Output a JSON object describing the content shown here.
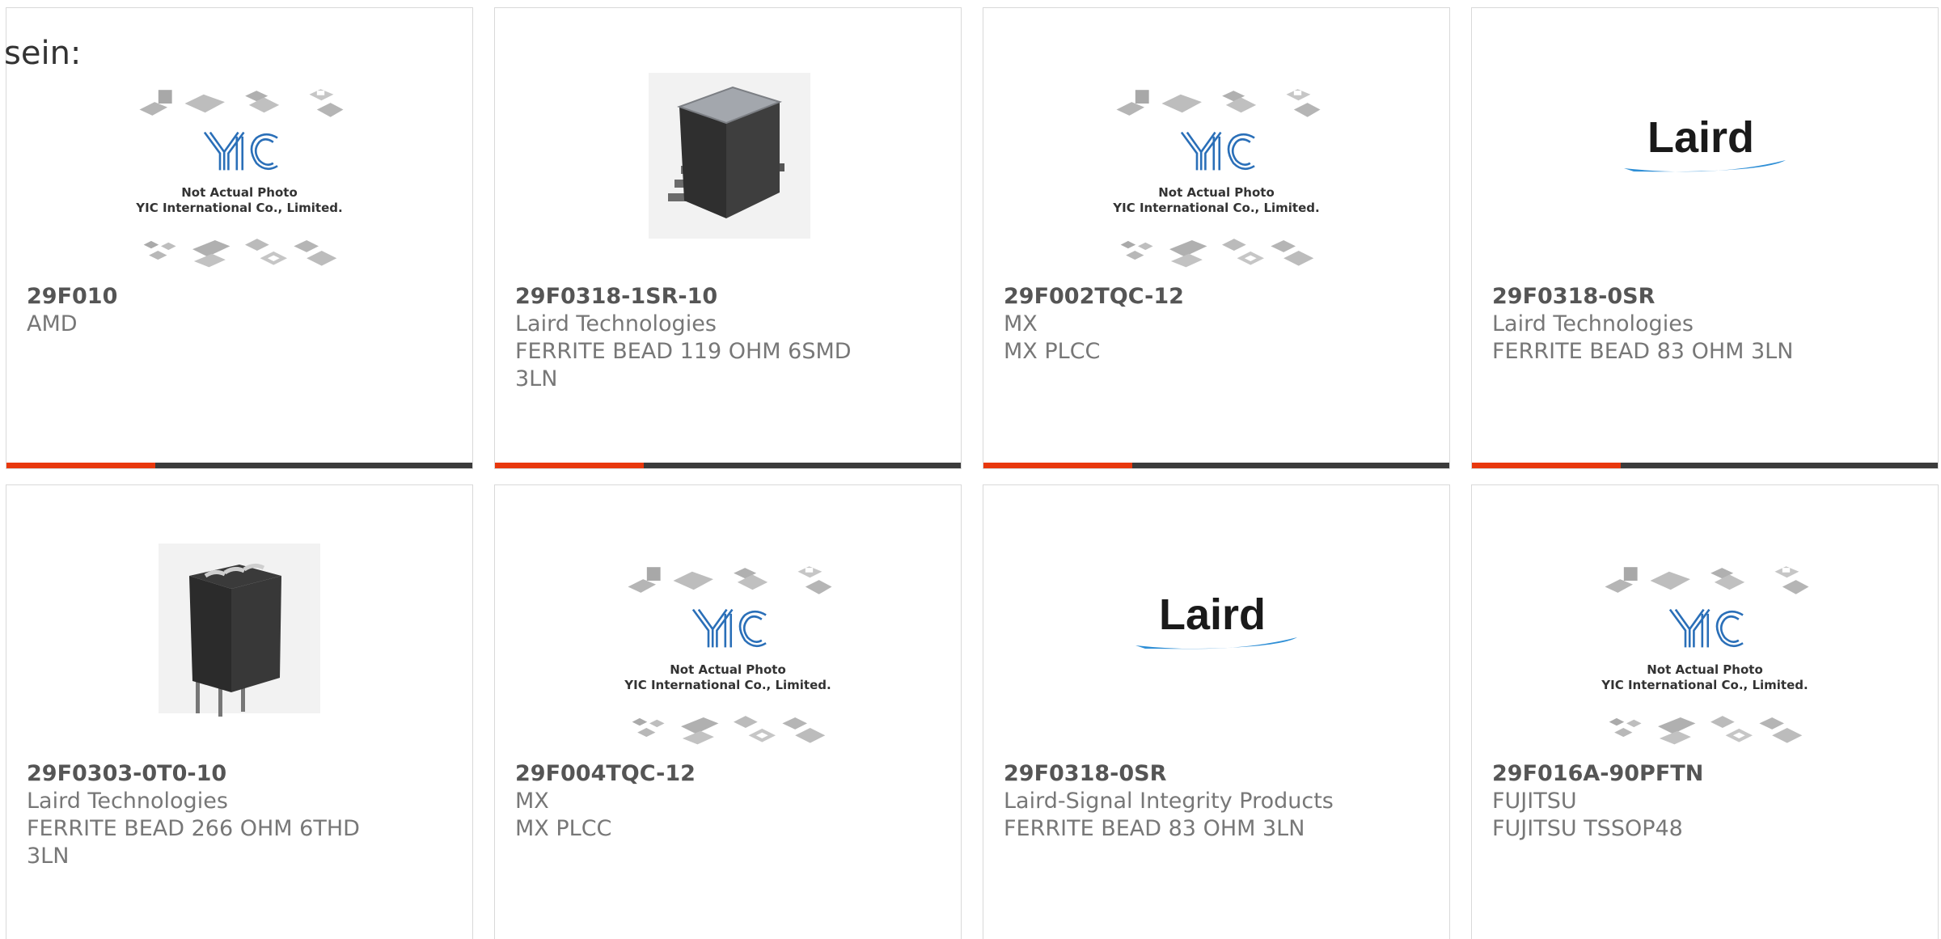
{
  "intro_text": "sein:",
  "colors": {
    "accent": "#e8380d",
    "bar_dark": "#3b3b3b",
    "part_text": "#555555",
    "meta_text": "#777777",
    "laird_blue": "#2f8fd6",
    "yic_blue": "#2a6fb8"
  },
  "placeholder_text": {
    "line1": "Not Actual Photo",
    "line2": "YIC International Co., Limited."
  },
  "logo_text": {
    "laird": "Laird"
  },
  "products": [
    {
      "part": "29F010",
      "brand": "AMD",
      "desc": "",
      "image": "yic-placeholder"
    },
    {
      "part": "29F0318-1SR-10",
      "brand": "Laird Technologies",
      "desc": "FERRITE BEAD 119 OHM 6SMD 3LN",
      "image": "ferrite-smd-photo"
    },
    {
      "part": "29F002TQC-12",
      "brand": "MX",
      "desc": "MX PLCC",
      "image": "yic-placeholder"
    },
    {
      "part": "29F0318-0SR",
      "brand": "Laird Technologies",
      "desc": "FERRITE BEAD 83 OHM 3LN",
      "image": "laird-logo"
    },
    {
      "part": "29F0303-0T0-10",
      "brand": "Laird Technologies",
      "desc": "FERRITE BEAD 266 OHM 6THD 3LN",
      "image": "ferrite-thd-photo"
    },
    {
      "part": "29F004TQC-12",
      "brand": "MX",
      "desc": "MX PLCC",
      "image": "yic-placeholder"
    },
    {
      "part": "29F0318-0SR",
      "brand": "Laird-Signal Integrity Products",
      "desc": "FERRITE BEAD 83 OHM 3LN",
      "image": "laird-logo"
    },
    {
      "part": "29F016A-90PFTN",
      "brand": "FUJITSU",
      "desc": "FUJITSU TSSOP48",
      "image": "yic-placeholder"
    }
  ]
}
